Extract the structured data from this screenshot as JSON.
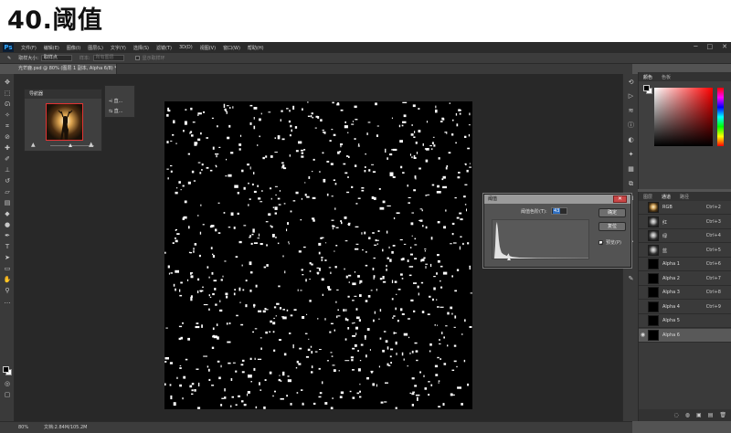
{
  "heading": "40.阈值",
  "menubar": {
    "logo": "Ps",
    "items": [
      "文件(F)",
      "编辑(E)",
      "图像(I)",
      "图层(L)",
      "文字(Y)",
      "选择(S)",
      "滤镜(T)",
      "3D(D)",
      "视图(V)",
      "窗口(W)",
      "帮助(H)"
    ],
    "window_controls": [
      "─",
      "□",
      "✕"
    ]
  },
  "options": {
    "brush_size_label": "取样大小:",
    "brush_size_value": "取样点",
    "sample_label": "样本:",
    "sample_value": "所有图层",
    "show_ring": "显示取样环"
  },
  "document": {
    "tab_label": "光芒鹿.psd @ 80% (图层 1 副本, Alpha 6/8) *",
    "zoom": "80%",
    "doc_size": "文档:2.84M/105.2M"
  },
  "navigator": {
    "title": "导航器",
    "zoom_out": "▲",
    "zoom_in": "▲"
  },
  "mini_panel": {
    "row1": "直...",
    "row2": "直..."
  },
  "color_panel": {
    "tab_active": "颜色",
    "tab_other": "色板"
  },
  "channels_panel": {
    "tabs": [
      "图层",
      "通道",
      "路径"
    ],
    "channels": [
      {
        "name": "RGB",
        "shortcut": "Ctrl+2"
      },
      {
        "name": "红",
        "shortcut": "Ctrl+3"
      },
      {
        "name": "绿",
        "shortcut": "Ctrl+4"
      },
      {
        "name": "蓝",
        "shortcut": "Ctrl+5"
      },
      {
        "name": "Alpha 1",
        "shortcut": "Ctrl+6"
      },
      {
        "name": "Alpha 2",
        "shortcut": "Ctrl+7"
      },
      {
        "name": "Alpha 3",
        "shortcut": "Ctrl+8"
      },
      {
        "name": "Alpha 4",
        "shortcut": "Ctrl+9"
      },
      {
        "name": "Alpha 5",
        "shortcut": ""
      },
      {
        "name": "Alpha 6",
        "shortcut": ""
      }
    ],
    "footer_icons": [
      "◌",
      "◍",
      "▣",
      "▤",
      "🗑"
    ]
  },
  "threshold_dialog": {
    "title": "阈值",
    "close": "✕",
    "level_label": "阈值色阶(T):",
    "level_value": "43",
    "ok_label": "确定",
    "reset_label": "复位",
    "preview_label": "预览(P)",
    "preview_checked": true
  },
  "colors": {
    "ui_dark": "#2b2b2b",
    "ui_mid": "#535353",
    "canvas_bg": "#282828",
    "accent_blue": "#31a8ff",
    "close_red": "#c94747"
  }
}
